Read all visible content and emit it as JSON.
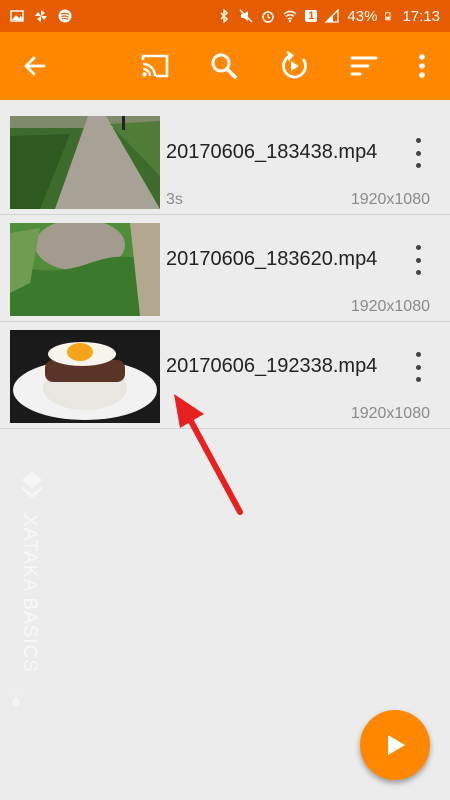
{
  "status_bar": {
    "battery": "43%",
    "time": "17:13",
    "sim_badge": "1",
    "icons": [
      "image-icon",
      "pinwheel-icon",
      "spotify-icon",
      "bluetooth-icon",
      "mute-icon",
      "alarm-icon",
      "wifi-icon",
      "signal-icon",
      "battery-icon"
    ]
  },
  "toolbar": {
    "icons": [
      "back-arrow-icon",
      "cast-icon",
      "search-icon",
      "refresh-play-icon",
      "sort-icon",
      "more-vert-icon"
    ],
    "color": "#ff8800"
  },
  "videos": [
    {
      "title": "20170606_183438.mp4",
      "duration": "3s",
      "resolution": "1920x1080"
    },
    {
      "title": "20170606_183620.mp4",
      "duration": "",
      "resolution": "1920x1080"
    },
    {
      "title": "20170606_192338.mp4",
      "duration": "",
      "resolution": "1920x1080"
    }
  ],
  "watermark": {
    "text": "XATAKA BASICS"
  },
  "annotation": {
    "type": "red-arrow",
    "color": "#e82020"
  },
  "fab": {
    "icon": "play-icon",
    "color": "#ff8800"
  }
}
